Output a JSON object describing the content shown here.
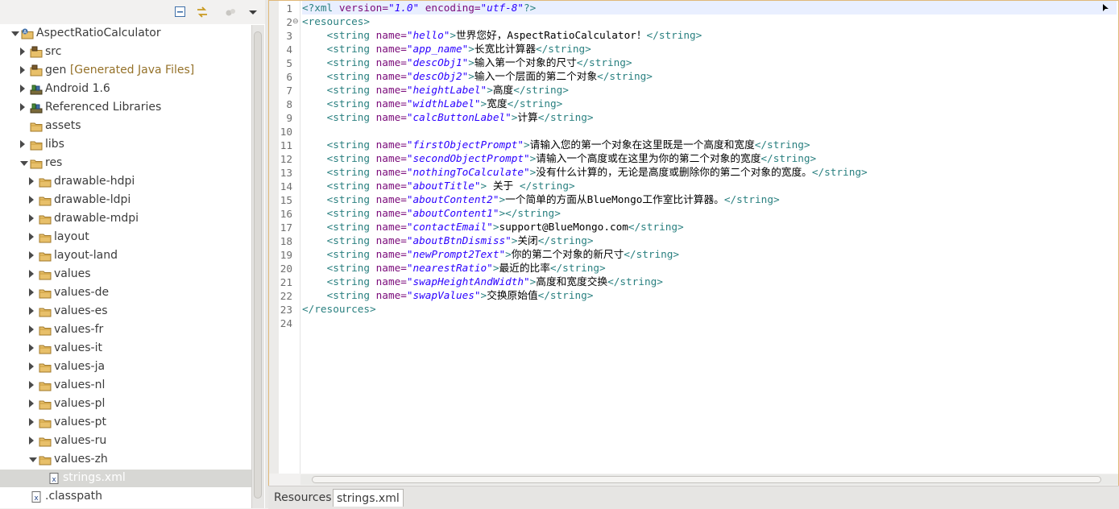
{
  "explorer": {
    "tree": [
      {
        "label": "AspectRatioCalculator",
        "depth": 0,
        "state": "expanded",
        "icon": "android-project-icon",
        "name": "project"
      },
      {
        "label": "src",
        "depth": 1,
        "state": "collapsed",
        "icon": "source-folder-icon",
        "name": "src"
      },
      {
        "label": "gen",
        "decoration": "[Generated Java Files]",
        "depth": 1,
        "state": "collapsed",
        "icon": "source-folder-icon",
        "name": "gen"
      },
      {
        "label": "Android 1.6",
        "depth": 1,
        "state": "collapsed",
        "icon": "library-icon",
        "name": "android-lib"
      },
      {
        "label": "Referenced Libraries",
        "depth": 1,
        "state": "collapsed",
        "icon": "library-icon",
        "name": "referenced-libraries"
      },
      {
        "label": "assets",
        "depth": 1,
        "state": "none",
        "icon": "folder-icon",
        "name": "assets"
      },
      {
        "label": "libs",
        "depth": 1,
        "state": "collapsed",
        "icon": "folder-icon",
        "name": "libs"
      },
      {
        "label": "res",
        "depth": 1,
        "state": "expanded",
        "icon": "folder-icon",
        "name": "res"
      },
      {
        "label": "drawable-hdpi",
        "depth": 2,
        "state": "collapsed",
        "icon": "folder-icon",
        "name": "drawable-hdpi"
      },
      {
        "label": "drawable-ldpi",
        "depth": 2,
        "state": "collapsed",
        "icon": "folder-icon",
        "name": "drawable-ldpi"
      },
      {
        "label": "drawable-mdpi",
        "depth": 2,
        "state": "collapsed",
        "icon": "folder-icon",
        "name": "drawable-mdpi"
      },
      {
        "label": "layout",
        "depth": 2,
        "state": "collapsed",
        "icon": "folder-icon",
        "name": "layout"
      },
      {
        "label": "layout-land",
        "depth": 2,
        "state": "collapsed",
        "icon": "folder-icon",
        "name": "layout-land"
      },
      {
        "label": "values",
        "depth": 2,
        "state": "collapsed",
        "icon": "folder-icon",
        "name": "values"
      },
      {
        "label": "values-de",
        "depth": 2,
        "state": "collapsed",
        "icon": "folder-icon",
        "name": "values-de"
      },
      {
        "label": "values-es",
        "depth": 2,
        "state": "collapsed",
        "icon": "folder-icon",
        "name": "values-es"
      },
      {
        "label": "values-fr",
        "depth": 2,
        "state": "collapsed",
        "icon": "folder-icon",
        "name": "values-fr"
      },
      {
        "label": "values-it",
        "depth": 2,
        "state": "collapsed",
        "icon": "folder-icon",
        "name": "values-it"
      },
      {
        "label": "values-ja",
        "depth": 2,
        "state": "collapsed",
        "icon": "folder-icon",
        "name": "values-ja"
      },
      {
        "label": "values-nl",
        "depth": 2,
        "state": "collapsed",
        "icon": "folder-icon",
        "name": "values-nl"
      },
      {
        "label": "values-pl",
        "depth": 2,
        "state": "collapsed",
        "icon": "folder-icon",
        "name": "values-pl"
      },
      {
        "label": "values-pt",
        "depth": 2,
        "state": "collapsed",
        "icon": "folder-icon",
        "name": "values-pt"
      },
      {
        "label": "values-ru",
        "depth": 2,
        "state": "collapsed",
        "icon": "folder-icon",
        "name": "values-ru"
      },
      {
        "label": "values-zh",
        "depth": 2,
        "state": "expanded",
        "icon": "folder-icon",
        "name": "values-zh"
      },
      {
        "label": "strings.xml",
        "depth": 3,
        "state": "none",
        "icon": "xml-file-icon",
        "name": "strings-xml",
        "selected": true
      },
      {
        "label": ".classpath",
        "depth": 1,
        "state": "none",
        "icon": "xml-file-icon",
        "name": "classpath"
      }
    ]
  },
  "editor": {
    "lines": [
      [
        [
          "tag",
          "<?xml "
        ],
        [
          "attr",
          "version="
        ],
        [
          "val",
          "\"1.0\""
        ],
        [
          "txt",
          " "
        ],
        [
          "attr",
          "encoding="
        ],
        [
          "val",
          "\"utf-8\""
        ],
        [
          "tag",
          "?>"
        ]
      ],
      [
        [
          "tag",
          "<resources>"
        ]
      ],
      [
        [
          "txt",
          "    "
        ],
        [
          "tag",
          "<string "
        ],
        [
          "attr",
          "name="
        ],
        [
          "val",
          "\"hello\""
        ],
        [
          "tag",
          ">"
        ],
        [
          "txt",
          "世界您好，AspectRatioCalculator！"
        ],
        [
          "tag",
          "</string>"
        ]
      ],
      [
        [
          "txt",
          "    "
        ],
        [
          "tag",
          "<string "
        ],
        [
          "attr",
          "name="
        ],
        [
          "val",
          "\"app_name\""
        ],
        [
          "tag",
          ">"
        ],
        [
          "txt",
          "长宽比计算器"
        ],
        [
          "tag",
          "</string>"
        ]
      ],
      [
        [
          "txt",
          "    "
        ],
        [
          "tag",
          "<string "
        ],
        [
          "attr",
          "name="
        ],
        [
          "val",
          "\"descObj1\""
        ],
        [
          "tag",
          ">"
        ],
        [
          "txt",
          "输入第一个对象的尺寸"
        ],
        [
          "tag",
          "</string>"
        ]
      ],
      [
        [
          "txt",
          "    "
        ],
        [
          "tag",
          "<string "
        ],
        [
          "attr",
          "name="
        ],
        [
          "val",
          "\"descObj2\""
        ],
        [
          "tag",
          ">"
        ],
        [
          "txt",
          "输入一个层面的第二个对象"
        ],
        [
          "tag",
          "</string>"
        ]
      ],
      [
        [
          "txt",
          "    "
        ],
        [
          "tag",
          "<string "
        ],
        [
          "attr",
          "name="
        ],
        [
          "val",
          "\"heightLabel\""
        ],
        [
          "tag",
          ">"
        ],
        [
          "txt",
          "高度"
        ],
        [
          "tag",
          "</string>"
        ]
      ],
      [
        [
          "txt",
          "    "
        ],
        [
          "tag",
          "<string "
        ],
        [
          "attr",
          "name="
        ],
        [
          "val",
          "\"widthLabel\""
        ],
        [
          "tag",
          ">"
        ],
        [
          "txt",
          "宽度"
        ],
        [
          "tag",
          "</string>"
        ]
      ],
      [
        [
          "txt",
          "    "
        ],
        [
          "tag",
          "<string "
        ],
        [
          "attr",
          "name="
        ],
        [
          "val",
          "\"calcButtonLabel\""
        ],
        [
          "tag",
          ">"
        ],
        [
          "txt",
          "计算"
        ],
        [
          "tag",
          "</string>"
        ]
      ],
      [
        [
          "txt",
          ""
        ]
      ],
      [
        [
          "txt",
          "    "
        ],
        [
          "tag",
          "<string "
        ],
        [
          "attr",
          "name="
        ],
        [
          "val",
          "\"firstObjectPrompt\""
        ],
        [
          "tag",
          ">"
        ],
        [
          "txt",
          "请输入您的第一个对象在这里既是一个高度和宽度"
        ],
        [
          "tag",
          "</string>"
        ]
      ],
      [
        [
          "txt",
          "    "
        ],
        [
          "tag",
          "<string "
        ],
        [
          "attr",
          "name="
        ],
        [
          "val",
          "\"secondObjectPrompt\""
        ],
        [
          "tag",
          ">"
        ],
        [
          "txt",
          "请输入一个高度或在这里为你的第二个对象的宽度"
        ],
        [
          "tag",
          "</string>"
        ]
      ],
      [
        [
          "txt",
          "    "
        ],
        [
          "tag",
          "<string "
        ],
        [
          "attr",
          "name="
        ],
        [
          "val",
          "\"nothingToCalculate\""
        ],
        [
          "tag",
          ">"
        ],
        [
          "txt",
          "没有什么计算的，无论是高度或删除你的第二个对象的宽度。"
        ],
        [
          "tag",
          "</string>"
        ]
      ],
      [
        [
          "txt",
          "    "
        ],
        [
          "tag",
          "<string "
        ],
        [
          "attr",
          "name="
        ],
        [
          "val",
          "\"aboutTitle\""
        ],
        [
          "tag",
          ">"
        ],
        [
          "txt",
          " 关于 "
        ],
        [
          "tag",
          "</string>"
        ]
      ],
      [
        [
          "txt",
          "    "
        ],
        [
          "tag",
          "<string "
        ],
        [
          "attr",
          "name="
        ],
        [
          "val",
          "\"aboutContent2\""
        ],
        [
          "tag",
          ">"
        ],
        [
          "txt",
          "一个简单的方面从BlueMongo工作室比计算器。"
        ],
        [
          "tag",
          "</string>"
        ]
      ],
      [
        [
          "txt",
          "    "
        ],
        [
          "tag",
          "<string "
        ],
        [
          "attr",
          "name="
        ],
        [
          "val",
          "\"aboutContent1\""
        ],
        [
          "tag",
          "></string>"
        ]
      ],
      [
        [
          "txt",
          "    "
        ],
        [
          "tag",
          "<string "
        ],
        [
          "attr",
          "name="
        ],
        [
          "val",
          "\"contactEmail\""
        ],
        [
          "tag",
          ">"
        ],
        [
          "txt",
          "support@BlueMongo.com"
        ],
        [
          "tag",
          "</string>"
        ]
      ],
      [
        [
          "txt",
          "    "
        ],
        [
          "tag",
          "<string "
        ],
        [
          "attr",
          "name="
        ],
        [
          "val",
          "\"aboutBtnDismiss\""
        ],
        [
          "tag",
          ">"
        ],
        [
          "txt",
          "关闭"
        ],
        [
          "tag",
          "</string>"
        ]
      ],
      [
        [
          "txt",
          "    "
        ],
        [
          "tag",
          "<string "
        ],
        [
          "attr",
          "name="
        ],
        [
          "val",
          "\"newPrompt2Text\""
        ],
        [
          "tag",
          ">"
        ],
        [
          "txt",
          "你的第二个对象的新尺寸"
        ],
        [
          "tag",
          "</string>"
        ]
      ],
      [
        [
          "txt",
          "    "
        ],
        [
          "tag",
          "<string "
        ],
        [
          "attr",
          "name="
        ],
        [
          "val",
          "\"nearestRatio\""
        ],
        [
          "tag",
          ">"
        ],
        [
          "txt",
          "最近的比率"
        ],
        [
          "tag",
          "</string>"
        ]
      ],
      [
        [
          "txt",
          "    "
        ],
        [
          "tag",
          "<string "
        ],
        [
          "attr",
          "name="
        ],
        [
          "val",
          "\"swapHeightAndWidth\""
        ],
        [
          "tag",
          ">"
        ],
        [
          "txt",
          "高度和宽度交换"
        ],
        [
          "tag",
          "</string>"
        ]
      ],
      [
        [
          "txt",
          "    "
        ],
        [
          "tag",
          "<string "
        ],
        [
          "attr",
          "name="
        ],
        [
          "val",
          "\"swapValues\""
        ],
        [
          "tag",
          ">"
        ],
        [
          "txt",
          "交换原始值"
        ],
        [
          "tag",
          "</string>"
        ]
      ],
      [
        [
          "tag",
          "</resources>"
        ]
      ],
      [
        [
          "txt",
          ""
        ]
      ]
    ],
    "line_numbers": [
      "1",
      "2",
      "3",
      "4",
      "5",
      "6",
      "7",
      "8",
      "9",
      "10",
      "11",
      "12",
      "13",
      "14",
      "15",
      "16",
      "17",
      "18",
      "19",
      "20",
      "21",
      "22",
      "23",
      "24"
    ],
    "fold_marker": "⊖",
    "tabs": [
      {
        "label": "Resources",
        "name": "tab-resources"
      },
      {
        "label": "strings.xml",
        "name": "tab-strings-xml",
        "active": true
      }
    ]
  },
  "colors": {
    "tag": "#2a8080",
    "attribute": "#7a0a7a",
    "value": "#2a00ff",
    "selection": "#d7d7d4",
    "current_line": "#e9efff",
    "editor_border": "#e0b878"
  }
}
